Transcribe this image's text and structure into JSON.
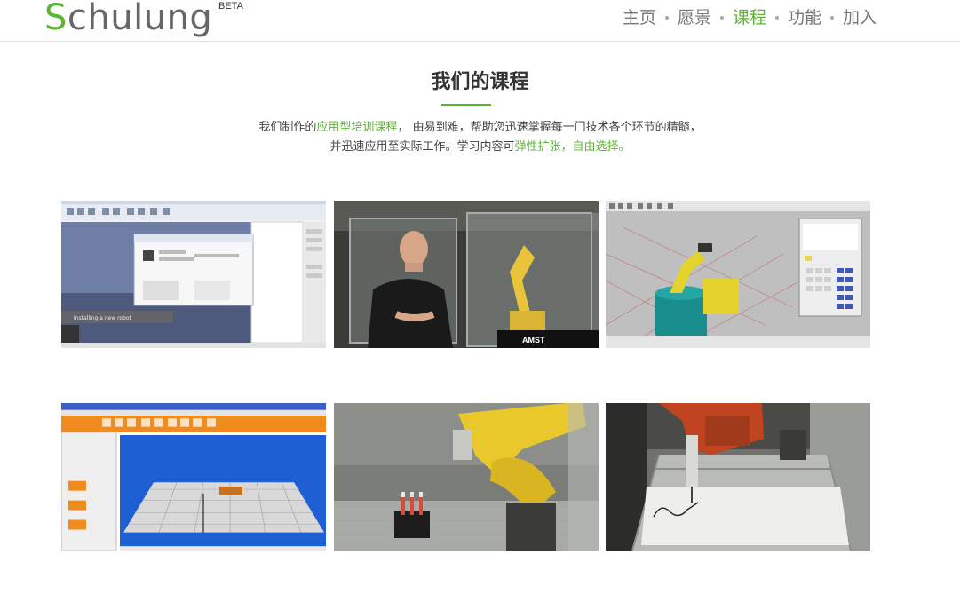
{
  "brand": {
    "first_letter": "S",
    "rest": "chulung",
    "badge": "BETA"
  },
  "nav": {
    "items": [
      {
        "label": "主页",
        "active": false
      },
      {
        "label": "愿景",
        "active": false
      },
      {
        "label": "课程",
        "active": true
      },
      {
        "label": "功能",
        "active": false
      },
      {
        "label": "加入",
        "active": false
      }
    ]
  },
  "courses": {
    "title": "我们的课程",
    "intro": {
      "line1_before": "我们制作的",
      "line1_highlight": "应用型培训课程",
      "line1_after": "， 由易到难，帮助您迅速掌握每一门技术各个环节的精髓，",
      "line2_before": "并迅速应用至实际工作。学习内容可",
      "line2_highlight": "弹性扩张，自由选择。"
    },
    "thumb1_caption": "Installing a new robot",
    "thumb2_logo": "AMST"
  },
  "colors": {
    "accent": "#5cb531",
    "nav_text": "#777777",
    "heading": "#333333"
  }
}
